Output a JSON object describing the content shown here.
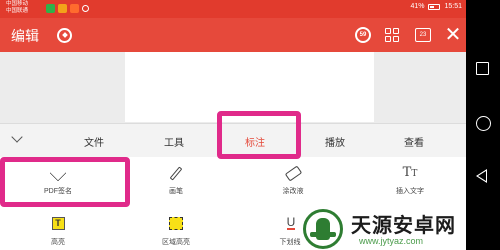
{
  "status_bar": {
    "carrier_1": "中国移动",
    "carrier_2": "中国联通",
    "battery": "41%",
    "time": "15:51"
  },
  "toolbar": {
    "title": "编辑",
    "read_badge": "59",
    "page_count": "23"
  },
  "menu_tabs": {
    "items": [
      {
        "label": "文件",
        "active": false
      },
      {
        "label": "工具",
        "active": false
      },
      {
        "label": "标注",
        "active": true
      },
      {
        "label": "播放",
        "active": false
      },
      {
        "label": "查看",
        "active": false
      }
    ]
  },
  "annotation_tools": [
    {
      "label": "PDF签名",
      "icon": "signature-pen-icon"
    },
    {
      "label": "画笔",
      "icon": "pencil-icon"
    },
    {
      "label": "涂改液",
      "icon": "eraser-icon"
    },
    {
      "label": "插入文字",
      "icon": "insert-text-icon"
    },
    {
      "label": "高亮",
      "icon": "highlight-icon"
    },
    {
      "label": "区域高亮",
      "icon": "area-highlight-icon"
    },
    {
      "label": "下划线",
      "icon": "underline-icon"
    }
  ],
  "watermark": {
    "title": "天源安卓网",
    "url": "www.jytyaz.com"
  },
  "colors": {
    "toolbar": "#e6493b",
    "status_bar": "#e13b2d",
    "accent": "#e4493a",
    "highlight_frame": "#e02a8a",
    "highlight_yellow": "#f7e017"
  }
}
